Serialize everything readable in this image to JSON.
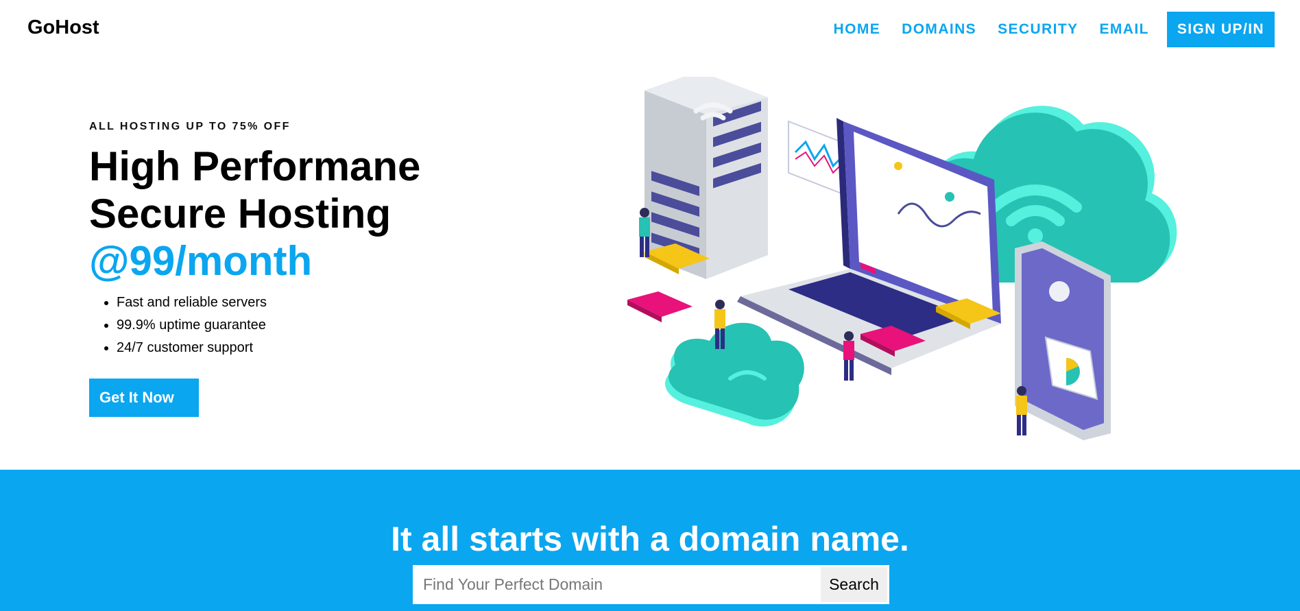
{
  "brand": {
    "name": "GoHost",
    "accent_color": "#0aa6f0"
  },
  "nav": {
    "links": [
      "HOME",
      "DOMAINS",
      "SECURITY",
      "EMAIL"
    ],
    "cta_label": "SIGN UP/IN"
  },
  "hero": {
    "tagline": "ALL HOSTING UP TO 75% OFF",
    "headline_line1": "High Performane",
    "headline_line2": "Secure Hosting",
    "headline_price": "@99/month",
    "features": [
      "Fast and reliable servers",
      "99.9% uptime guarantee",
      "24/7 customer support"
    ],
    "cta_label": "Get It Now",
    "illustration_icon": "cloud-hosting-illustration"
  },
  "domain_search": {
    "title": "It all starts with a domain name.",
    "placeholder": "Find Your Perfect Domain",
    "value": "",
    "button_label": "Search"
  }
}
